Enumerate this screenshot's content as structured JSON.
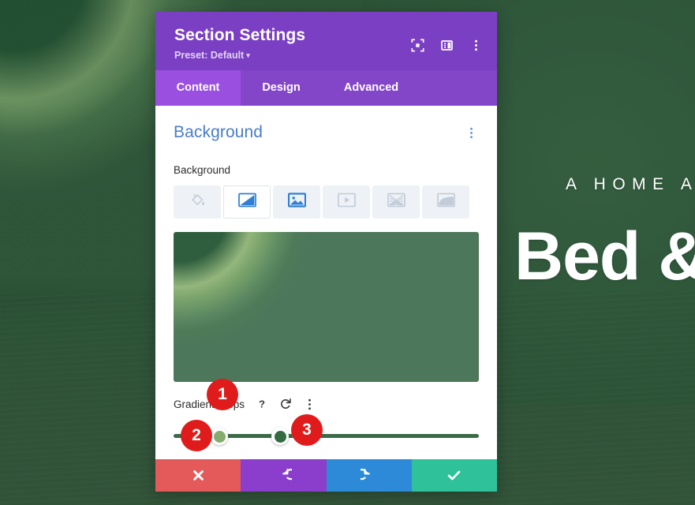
{
  "page": {
    "hero_kicker": "A HOME A",
    "hero_headline": "Bed &"
  },
  "modal": {
    "title": "Section Settings",
    "preset_label": "Preset: Default",
    "preset_caret": "▾",
    "header_icons": [
      {
        "name": "focus-icon",
        "label": "focus"
      },
      {
        "name": "layout-icon",
        "label": "layout"
      },
      {
        "name": "more-vertical-icon",
        "label": "more"
      }
    ],
    "tabs": [
      {
        "label": "Content",
        "active": true
      },
      {
        "label": "Design",
        "active": false
      },
      {
        "label": "Advanced",
        "active": false
      }
    ],
    "section": {
      "title": "Background",
      "menu_icon": "more-vertical-icon"
    },
    "background_field": {
      "label": "Background",
      "types": [
        {
          "name": "color-fill",
          "selected": false
        },
        {
          "name": "gradient",
          "selected": true
        },
        {
          "name": "image",
          "selected": false
        },
        {
          "name": "video",
          "selected": false
        },
        {
          "name": "pattern",
          "selected": false
        },
        {
          "name": "mask",
          "selected": false
        }
      ]
    },
    "gradient_preview": {
      "colors": [
        "#2f5e3e",
        "#93b67c",
        "#4c775a"
      ]
    },
    "gradient_stops": {
      "label": "Gradient Stops",
      "help_icon": "?",
      "reset_icon": "↺",
      "menu_icon": "⋮",
      "stops": [
        {
          "position_pct": 15,
          "color": "#85ab6e"
        },
        {
          "position_pct": 35,
          "color": "#336b41"
        }
      ],
      "track_color": "#3c6b47"
    },
    "footer_buttons": [
      {
        "name": "cancel-button",
        "icon": "✖",
        "color": "#e45a5a"
      },
      {
        "name": "undo-button",
        "icon": "↺",
        "color": "#8a3ecb"
      },
      {
        "name": "redo-button",
        "icon": "↻",
        "color": "#2d8ad8"
      },
      {
        "name": "save-button",
        "icon": "✔",
        "color": "#2ec19a"
      }
    ]
  },
  "callouts": [
    {
      "number": "1"
    },
    {
      "number": "2"
    },
    {
      "number": "3"
    }
  ],
  "colors": {
    "header_purple": "#7b3fc4",
    "tab_purple": "#8446c9",
    "tab_active_purple": "#9a4fe0",
    "section_title_blue": "#4a7dc9",
    "badge_red": "#e01b1b"
  }
}
